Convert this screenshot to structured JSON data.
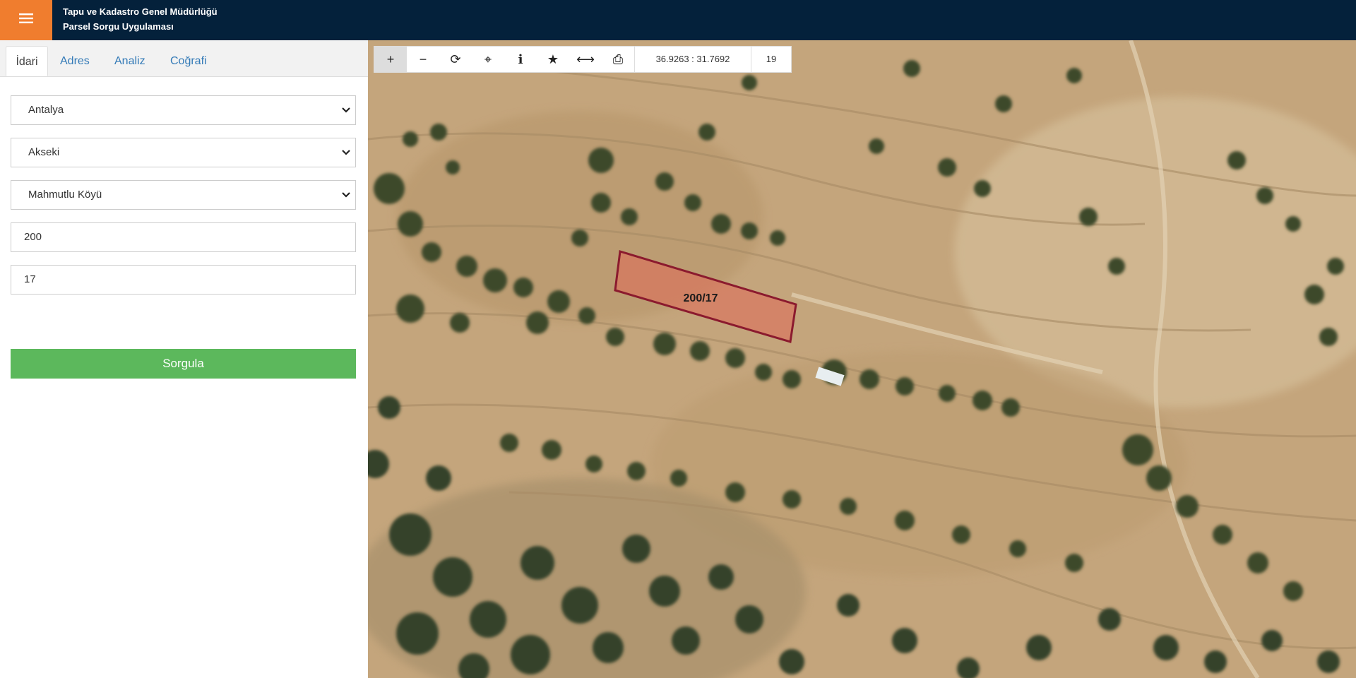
{
  "header": {
    "title_line1": "Tapu ve Kadastro Genel Müdürlüğü",
    "title_line2": "Parsel Sorgu Uygulaması",
    "menu_icon": "hamburger-icon",
    "brand_color": "#f07d2e",
    "bar_color": "#04213b"
  },
  "tabs": [
    {
      "label": "İdari",
      "active": true
    },
    {
      "label": "Adres",
      "active": false
    },
    {
      "label": "Analiz",
      "active": false
    },
    {
      "label": "Coğrafi",
      "active": false
    }
  ],
  "form": {
    "province": "Antalya",
    "district": "Akseki",
    "neighborhood": "Mahmutlu Köyü",
    "block": "200",
    "parcel": "17",
    "submit_label": "Sorgula",
    "submit_color": "#5cb85c"
  },
  "map": {
    "toolbar": [
      {
        "icon": "plus-icon",
        "glyph": "+"
      },
      {
        "icon": "minus-icon",
        "glyph": "−"
      },
      {
        "icon": "refresh-icon",
        "glyph": "⟳"
      },
      {
        "icon": "crosshair-icon",
        "glyph": "⌖"
      },
      {
        "icon": "info-icon",
        "glyph": "i"
      },
      {
        "icon": "star-icon",
        "glyph": "★"
      },
      {
        "icon": "measure-icon",
        "glyph": "⟷"
      },
      {
        "icon": "print-icon",
        "glyph": "⎙"
      }
    ],
    "coordinates": "36.9263 : 31.7692",
    "zoom": "19",
    "parcel_label": "200/17",
    "parcel_stroke": "#8b1a2e"
  }
}
